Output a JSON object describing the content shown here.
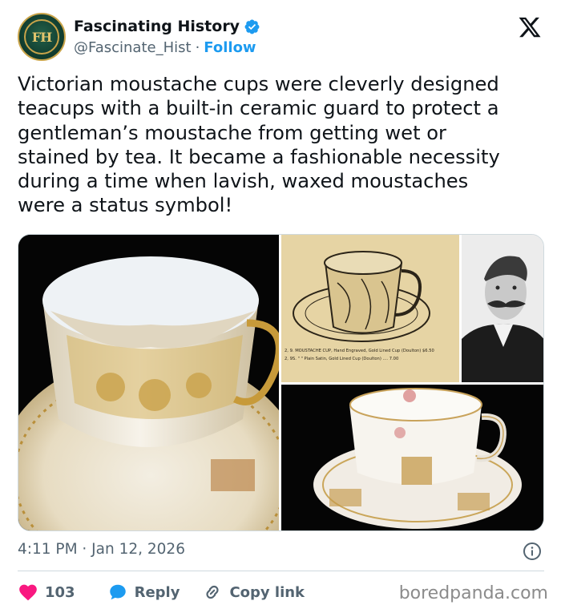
{
  "author": {
    "name": "Fascinating History",
    "handle": "@Fascinate_Hist",
    "separator": "·",
    "follow_label": "Follow",
    "avatar_text": "FH",
    "verified": true
  },
  "tweet": {
    "text": "Victorian moustache cups were cleverly designed\nteacups with a built-in ceramic guard to protect a\ngentleman’s moustache from getting wet or\nstained by tea. It became a fashionable necessity\nduring a time when lavish, waxed moustaches\nwere a status symbol!",
    "timestamp": "4:11 PM · Jan 12, 2026"
  },
  "media": {
    "catalog_line_1": "2, 9.  MOUSTACHE CUP, Hand Engraved, Gold Lined Cup (Doulton)  $6.50",
    "catalog_line_2": "2, 9S.     \"        \"   Plain Satin, Gold Lined Cup (Doulton) ....  7.00"
  },
  "actions": {
    "likes_count": "103",
    "reply_label": "Reply",
    "copy_link_label": "Copy link"
  },
  "watermark": "boredpanda.com",
  "colors": {
    "accent": "#1d9bf0",
    "like": "#f91880",
    "text": "#0f1419",
    "muted": "#536471",
    "border": "#cfd9de"
  },
  "icons": [
    "verified-badge-icon",
    "x-logo-icon",
    "info-icon",
    "heart-icon",
    "reply-bubble-icon",
    "link-icon"
  ]
}
